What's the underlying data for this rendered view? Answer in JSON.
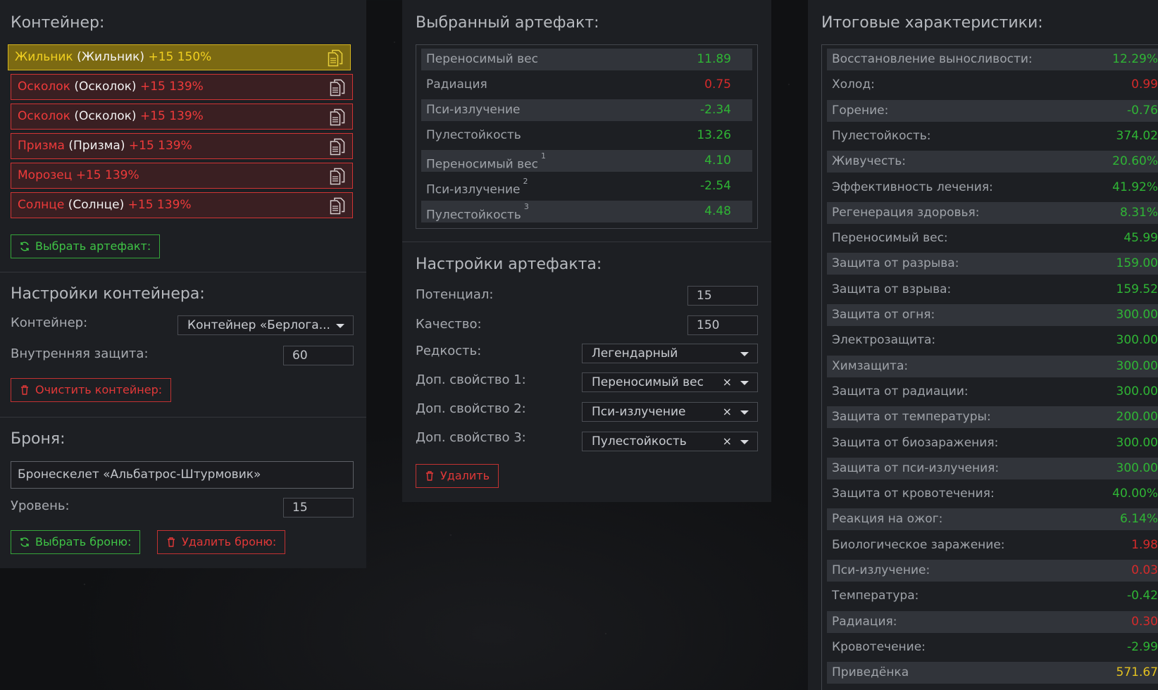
{
  "left": {
    "container_title": "Контейнер:",
    "items": [
      {
        "name": "Жильник",
        "orig": "(Жильник)",
        "level": "+15 150%",
        "style": "gold"
      },
      {
        "name": "Осколок",
        "orig": "(Осколок)",
        "level": "+15 139%",
        "style": "red"
      },
      {
        "name": "Осколок",
        "orig": "(Осколок)",
        "level": "+15 139%",
        "style": "red"
      },
      {
        "name": "Призма",
        "orig": "(Призма)",
        "level": "+15 139%",
        "style": "red"
      },
      {
        "name": "Морозец",
        "orig": "",
        "level": "+15 139%",
        "style": "red"
      },
      {
        "name": "Солнце",
        "orig": "(Солнце)",
        "level": "+15 139%",
        "style": "red"
      }
    ],
    "choose_artifact_btn": "Выбрать артефакт:",
    "container_settings_title": "Настройки контейнера:",
    "container_label": "Контейнер:",
    "container_value": "Контейнер «Берлога...",
    "inner_protection_label": "Внутренняя защита:",
    "inner_protection_value": "60",
    "clear_container_btn": "Очистить контейнер:",
    "armor_title": "Броня:",
    "armor_value": "Бронескелет «Альбатрос-Штурмовик»",
    "level_label": "Уровень:",
    "level_value": "15",
    "choose_armor_btn": "Выбрать броню:",
    "delete_armor_btn": "Удалить броню:"
  },
  "middle": {
    "selected_title": "Выбранный артефакт:",
    "stats": [
      {
        "label": "Переносимый вес",
        "sup": "",
        "value": "11.89",
        "tone": "pos"
      },
      {
        "label": "Радиация",
        "sup": "",
        "value": "0.75",
        "tone": "neg"
      },
      {
        "label": "Пси-излучение",
        "sup": "",
        "value": "-2.34",
        "tone": "pos"
      },
      {
        "label": "Пулестойкость",
        "sup": "",
        "value": "13.26",
        "tone": "pos"
      },
      {
        "label": "Переносимый вес",
        "sup": "1",
        "value": "4.10",
        "tone": "pos"
      },
      {
        "label": "Пси-излучение",
        "sup": "2",
        "value": "-2.54",
        "tone": "pos"
      },
      {
        "label": "Пулестойкость",
        "sup": "3",
        "value": "4.48",
        "tone": "pos"
      }
    ],
    "settings_title": "Настройки артефакта:",
    "potential_label": "Потенциал:",
    "potential_value": "15",
    "quality_label": "Качество:",
    "quality_value": "150",
    "rarity_label": "Редкость:",
    "rarity_value": "Легендарный",
    "extra1_label": "Доп. свойство 1:",
    "extra1_value": "Переносимый вес",
    "extra2_label": "Доп. свойство 2:",
    "extra2_value": "Пси-излучение",
    "extra3_label": "Доп. свойство 3:",
    "extra3_value": "Пулестойкость",
    "clear_symbol": "×",
    "delete_btn": "Удалить"
  },
  "right": {
    "title": "Итоговые характеристики:",
    "stats": [
      {
        "label": "Восстановление выносливости:",
        "value": "12.29%",
        "tone": "pos"
      },
      {
        "label": "Холод:",
        "value": "0.99",
        "tone": "neg"
      },
      {
        "label": "Горение:",
        "value": "-0.76",
        "tone": "pos"
      },
      {
        "label": "Пулестойкость:",
        "value": "374.02",
        "tone": "pos"
      },
      {
        "label": "Живучесть:",
        "value": "20.60%",
        "tone": "pos"
      },
      {
        "label": "Эффективность лечения:",
        "value": "41.92%",
        "tone": "pos"
      },
      {
        "label": "Регенерация здоровья:",
        "value": "8.31%",
        "tone": "pos"
      },
      {
        "label": "Переносимый вес:",
        "value": "45.99",
        "tone": "pos"
      },
      {
        "label": "Защита от разрыва:",
        "value": "159.00",
        "tone": "pos"
      },
      {
        "label": "Защита от взрыва:",
        "value": "159.52",
        "tone": "pos"
      },
      {
        "label": "Защита от огня:",
        "value": "300.00",
        "tone": "pos"
      },
      {
        "label": "Электрозащита:",
        "value": "300.00",
        "tone": "pos"
      },
      {
        "label": "Химзащита:",
        "value": "300.00",
        "tone": "pos"
      },
      {
        "label": "Защита от радиации:",
        "value": "300.00",
        "tone": "pos"
      },
      {
        "label": "Защита от температуры:",
        "value": "200.00",
        "tone": "pos"
      },
      {
        "label": "Защита от биозаражения:",
        "value": "300.00",
        "tone": "pos"
      },
      {
        "label": "Защита от пси-излучения:",
        "value": "300.00",
        "tone": "pos"
      },
      {
        "label": "Защита от кровотечения:",
        "value": "40.00%",
        "tone": "pos"
      },
      {
        "label": "Реакция на ожог:",
        "value": "6.14%",
        "tone": "pos"
      },
      {
        "label": "Биологическое заражение:",
        "value": "1.98",
        "tone": "neg"
      },
      {
        "label": "Пси-излучение:",
        "value": "0.03",
        "tone": "neg"
      },
      {
        "label": "Температура:",
        "value": "-0.42",
        "tone": "pos"
      },
      {
        "label": "Радиация:",
        "value": "0.30",
        "tone": "neg"
      },
      {
        "label": "Кровотечение:",
        "value": "-2.99",
        "tone": "pos"
      },
      {
        "label": "Приведёнка",
        "value": "571.67",
        "tone": "gold"
      }
    ]
  }
}
